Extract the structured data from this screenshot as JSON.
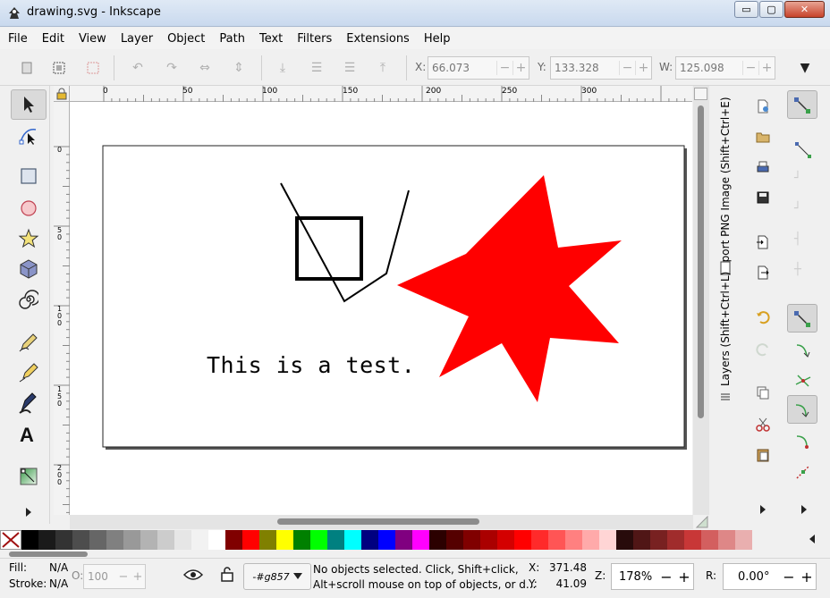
{
  "window": {
    "title": "drawing.svg - Inkscape",
    "minimize": "▭",
    "maximize": "▢",
    "close": "✕"
  },
  "menu": [
    "File",
    "Edit",
    "View",
    "Layer",
    "Object",
    "Path",
    "Text",
    "Filters",
    "Extensions",
    "Help"
  ],
  "toolbar": {
    "x_label": "X:",
    "x_value": "66.073",
    "y_label": "Y:",
    "y_value": "133.328",
    "w_label": "W:",
    "w_value": "125.098",
    "minus": "−",
    "plus": "+"
  },
  "ruler": {
    "h_ticks": [
      "0",
      "50",
      "100",
      "150",
      "200",
      "250",
      "300"
    ],
    "v_ticks": [
      "0",
      "5\n0",
      "1\n0\n0",
      "1\n5\n0",
      "2\n0\n0"
    ]
  },
  "canvas": {
    "text": "This is a test.",
    "star_color": "#ff0000"
  },
  "dock": {
    "export_tab": "Export PNG Image (Shift+Ctrl+E)",
    "layers_tab": "Layers (Shift+Ctrl+L)"
  },
  "palette": [
    "#000000",
    "#1a1a1a",
    "#333333",
    "#4d4d4d",
    "#666666",
    "#808080",
    "#999999",
    "#b3b3b3",
    "#cccccc",
    "#e6e6e6",
    "#f2f2f2",
    "#ffffff",
    "#800000",
    "#ff0000",
    "#808000",
    "#ffff00",
    "#008000",
    "#00ff00",
    "#008080",
    "#00ffff",
    "#000080",
    "#0000ff",
    "#800080",
    "#ff00ff",
    "#2b0000",
    "#550000",
    "#800000",
    "#aa0000",
    "#d40000",
    "#ff0000",
    "#ff2a2a",
    "#ff5555",
    "#ff8080",
    "#ffaaaa",
    "#ffd5d5",
    "#280b0b",
    "#501616",
    "#782121",
    "#a02c2c",
    "#c83737",
    "#d35f5f",
    "#de8787",
    "#e9afaf"
  ],
  "status": {
    "fill_label": "Fill:",
    "fill_value": "N/A",
    "stroke_label": "Stroke:",
    "stroke_value": "N/A",
    "opacity_label": "O:",
    "opacity_value": "100",
    "layer": "-#g857",
    "message_line1": "No objects selected. Click, Shift+click,",
    "message_line2": "Alt+scroll mouse on top of objects, or d...",
    "x_label": "X:",
    "x_value": "371.48",
    "y_label": "Y:",
    "y_value": "41.09",
    "z_label": "Z:",
    "zoom": "178%",
    "r_label": "R:",
    "rotation": "0.00°"
  }
}
